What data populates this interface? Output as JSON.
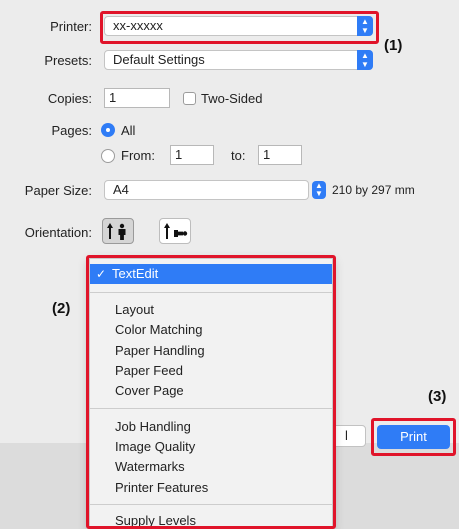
{
  "dialog": {
    "printer": {
      "label": "Printer:",
      "value": "xx-xxxxx"
    },
    "presets": {
      "label": "Presets:",
      "value": "Default Settings"
    },
    "copies": {
      "label": "Copies:",
      "value": "1",
      "two_sided_label": "Two-Sided",
      "two_sided_checked": false
    },
    "pages": {
      "label": "Pages:",
      "all_label": "All",
      "all_selected": true,
      "from_label": "From:",
      "from_value": "1",
      "to_label": "to:",
      "to_value": "1"
    },
    "paper_size": {
      "label": "Paper Size:",
      "value": "A4",
      "dimensions": "210 by 297 mm"
    },
    "orientation": {
      "label": "Orientation:",
      "options": [
        "portrait",
        "landscape"
      ],
      "selected": "portrait"
    },
    "cancel_fragment": "l",
    "print_button": "Print"
  },
  "menu": {
    "selected": "TextEdit",
    "group1": [
      "Layout",
      "Color Matching",
      "Paper Handling",
      "Paper Feed",
      "Cover Page"
    ],
    "group2": [
      "Job Handling",
      "Image Quality",
      "Watermarks",
      "Printer Features"
    ],
    "group3": [
      "Supply Levels"
    ]
  },
  "callouts": {
    "one": "(1)",
    "two": "(2)",
    "three": "(3)"
  },
  "colors": {
    "accent": "#2f7cf6",
    "highlight_box": "#e0142a"
  }
}
